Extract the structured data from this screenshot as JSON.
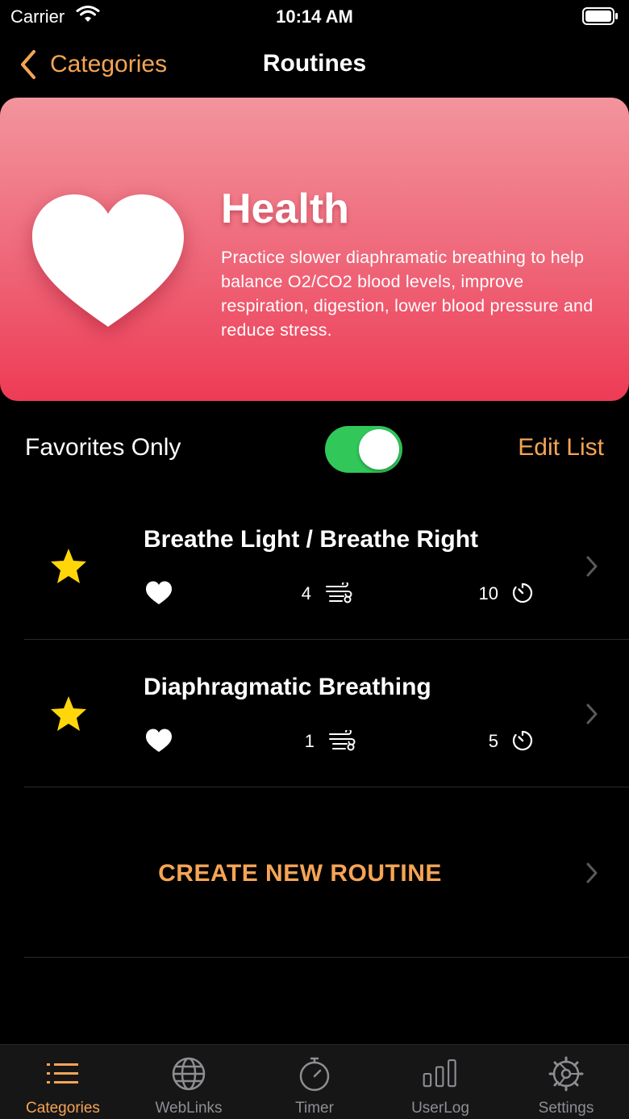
{
  "status_bar": {
    "carrier": "Carrier",
    "time": "10:14 AM"
  },
  "nav": {
    "back_label": "Categories",
    "title": "Routines"
  },
  "category": {
    "title": "Health",
    "description": "Practice slower diaphramatic breathing to help balance O2/CO2 blood levels, improve respiration, digestion, lower blood pressure and reduce stress.",
    "icon": "heart-icon"
  },
  "filter": {
    "label": "Favorites Only",
    "toggle_on": true,
    "edit_label": "Edit List"
  },
  "routines": [
    {
      "title": "Breathe Light / Breathe Right",
      "breaths": "4",
      "minutes": "10",
      "favorite": true
    },
    {
      "title": "Diaphragmatic Breathing",
      "breaths": "1",
      "minutes": "5",
      "favorite": true
    }
  ],
  "create": {
    "label": "CREATE NEW ROUTINE"
  },
  "tabs": [
    {
      "label": "Categories",
      "icon": "list-icon",
      "active": true
    },
    {
      "label": "WebLinks",
      "icon": "globe-icon",
      "active": false
    },
    {
      "label": "Timer",
      "icon": "stopwatch-icon",
      "active": false
    },
    {
      "label": "UserLog",
      "icon": "bar-chart-icon",
      "active": false
    },
    {
      "label": "Settings",
      "icon": "gear-icon",
      "active": false
    }
  ],
  "colors": {
    "accent": "#f5a455",
    "toggle_on": "#31c859",
    "star": "#ffd60a",
    "header_top": "#f3949c",
    "header_bottom": "#ee3b55"
  }
}
